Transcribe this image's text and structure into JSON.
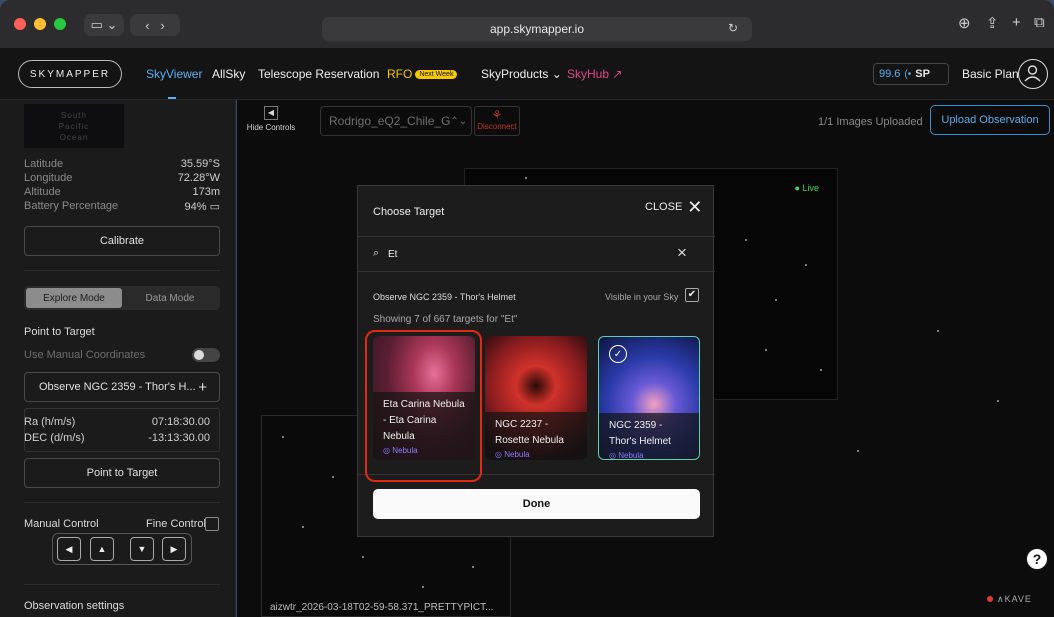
{
  "browser": {
    "url": "app.skymapper.io",
    "traffic_colors": [
      "#ff5f57",
      "#febc2e",
      "#28c840"
    ]
  },
  "header": {
    "logo": "SKYMAPPER",
    "nav": [
      {
        "label": "SkyViewer",
        "active": true
      },
      {
        "label": "AllSky"
      },
      {
        "label": "Telescope Reservation"
      },
      {
        "label": "RFO",
        "badge": "Next Week",
        "color": "#f5c800"
      },
      {
        "label": "SkyProducts",
        "caret": "⌄"
      },
      {
        "label": "SkyHub",
        "suffix": "↗",
        "color": "#e0468a"
      }
    ],
    "sp_value": "99.6",
    "sp_label": "SP",
    "plan": "Basic Plan"
  },
  "sidebar": {
    "map_labels": [
      "South",
      "Pacific",
      "Ocean"
    ],
    "stats": [
      {
        "label": "Latitude",
        "value": "35.59°S"
      },
      {
        "label": "Longitude",
        "value": "72.28°W"
      },
      {
        "label": "Altitude",
        "value": "173m"
      },
      {
        "label": "Battery Percentage",
        "value": "94%"
      }
    ],
    "calibrate": "Calibrate",
    "modes": {
      "explore": "Explore Mode",
      "data": "Data Mode"
    },
    "point_to_target_heading": "Point to Target",
    "use_manual": "Use Manual Coordinates",
    "target_value": "Observe NGC 2359 - Thor's H...",
    "ra_label": "Ra (h/m/s)",
    "ra_value": "07:18:30.00",
    "dec_label": "DEC (d/m/s)",
    "dec_value": "-13:13:30.00",
    "point_button": "Point to Target",
    "manual_control": "Manual Control",
    "fine_control": "Fine Control",
    "observation_settings": "Observation settings"
  },
  "toolbar": {
    "hide_controls": "Hide Controls",
    "telescope": "Rodrigo_eQ2_Chile_G",
    "disconnect": "Disconnect",
    "uploaded": "1/1 Images Uploaded",
    "upload_button": "Upload Observation"
  },
  "viewer": {
    "live": "Live",
    "thumb_caption": "aizwtr_2026-03-18T02-59-58.371_PRETTYPICT..."
  },
  "modal": {
    "title": "Choose Target",
    "close": "CLOSE",
    "search_value": "Et",
    "observe_title": "Observe NGC 2359 - Thor's Helmet",
    "visible_label": "Visible in your Sky",
    "showing": "Showing 7 of 667 targets for \"Et\"",
    "cards": [
      {
        "name": "Eta Carina Nebula - Eta Carina Nebula",
        "type": "Nebula",
        "selected": false
      },
      {
        "name": "NGC 2237 - Rosette Nebula",
        "type": "Nebula",
        "selected": false
      },
      {
        "name": "NGC 2359 - Thor's Helmet",
        "type": "Nebula",
        "selected": true
      }
    ],
    "done": "Done"
  }
}
